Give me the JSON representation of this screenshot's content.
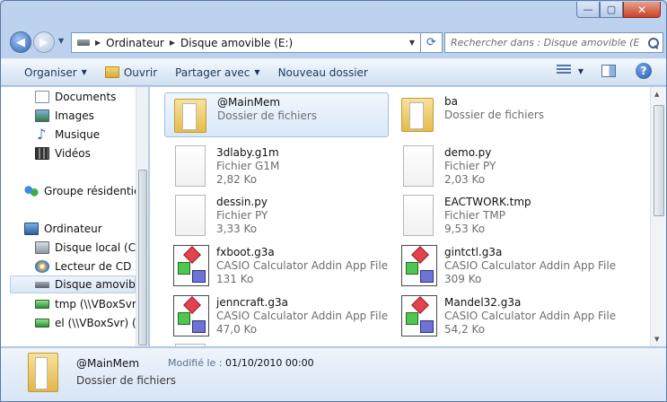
{
  "window": {
    "minimize_glyph": "—",
    "maximize_glyph": "▢",
    "close_glyph": "✕"
  },
  "nav": {
    "back_glyph": "◀",
    "forward_glyph": "▶",
    "recent_glyph": "▼",
    "breadcrumb": [
      "Ordinateur",
      "Disque amovible (E:)"
    ],
    "crumb_separator": "▶",
    "dropdown_glyph": "▼",
    "refresh_glyph": "⟳",
    "search_placeholder": "Rechercher dans : Disque amovible (E:)"
  },
  "commandbar": {
    "organize": "Organiser",
    "open": "Ouvrir",
    "share": "Partager avec",
    "new_folder": "Nouveau dossier",
    "caret": "▼",
    "help_glyph": "?"
  },
  "navpane": {
    "items": [
      {
        "label": "Documents",
        "icon": "documents-icon"
      },
      {
        "label": "Images",
        "icon": "images-icon"
      },
      {
        "label": "Musique",
        "icon": "music-icon"
      },
      {
        "label": "Vidéos",
        "icon": "videos-icon"
      },
      {
        "label": "Groupe résidentiel",
        "icon": "homegroup-icon"
      },
      {
        "label": "Ordinateur",
        "icon": "computer-icon"
      },
      {
        "label": "Disque local (C:)",
        "icon": "local-disk-icon"
      },
      {
        "label": "Lecteur de CD (D",
        "icon": "cd-drive-icon"
      },
      {
        "label": "Disque amovible",
        "icon": "removable-disk-icon"
      },
      {
        "label": "tmp (\\\\VBoxSvr)",
        "icon": "network-drive-icon"
      },
      {
        "label": "el (\\\\VBoxSvr) (Z:",
        "icon": "network-drive-icon"
      }
    ]
  },
  "files": [
    {
      "name": "@MainMem",
      "type": "Dossier de fichiers",
      "size": "",
      "icon": "folder-icon"
    },
    {
      "name": "ba",
      "type": "Dossier de fichiers",
      "size": "",
      "icon": "folder-icon"
    },
    {
      "name": "3dlaby.g1m",
      "type": "Fichier G1M",
      "size": "2,82 Ko",
      "icon": "file-icon"
    },
    {
      "name": "demo.py",
      "type": "Fichier PY",
      "size": "2,03 Ko",
      "icon": "file-icon"
    },
    {
      "name": "dessin.py",
      "type": "Fichier PY",
      "size": "3,33 Ko",
      "icon": "file-icon"
    },
    {
      "name": "EACTWORK.tmp",
      "type": "Fichier TMP",
      "size": "9,53 Ko",
      "icon": "file-icon"
    },
    {
      "name": "fxboot.g3a",
      "type": "CASIO Calculator Addin App File",
      "size": "131 Ko",
      "icon": "casio-addin-icon"
    },
    {
      "name": "gintctl.g3a",
      "type": "CASIO Calculator Addin App File",
      "size": "309 Ko",
      "icon": "casio-addin-icon"
    },
    {
      "name": "jenncraft.g3a",
      "type": "CASIO Calculator Addin App File",
      "size": "47,0 Ko",
      "icon": "casio-addin-icon"
    },
    {
      "name": "Mandel32.g3a",
      "type": "CASIO Calculator Addin App File",
      "size": "54,2 Ko",
      "icon": "casio-addin-icon"
    }
  ],
  "details": {
    "name": "@MainMem",
    "type": "Dossier de fichiers",
    "modified_label": "Modifié le :",
    "modified_value": "01/10/2010 00:00"
  },
  "scroll": {
    "up": "▲",
    "down": "▼"
  }
}
